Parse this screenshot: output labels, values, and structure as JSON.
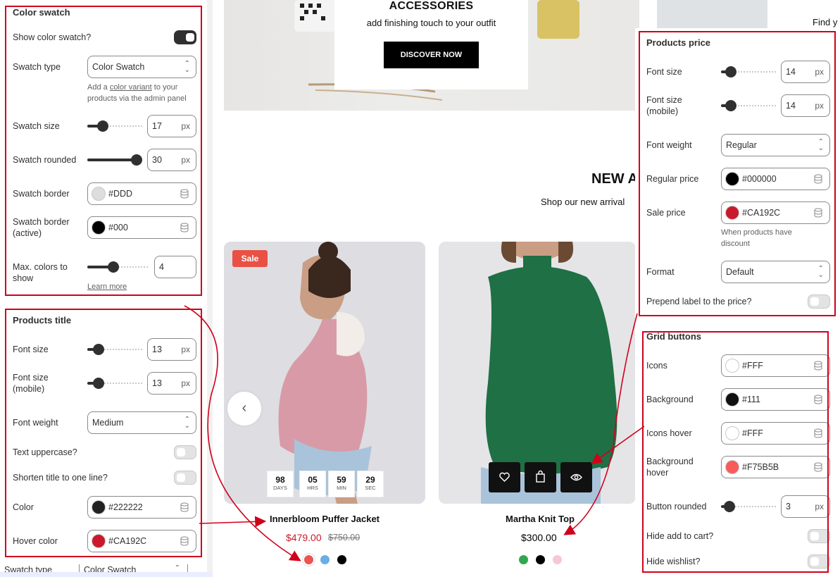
{
  "store": {
    "hero_title": "ACCESSORIES",
    "hero_subtitle": "add finishing touch to your outfit",
    "hero_button": "DISCOVER NOW",
    "find_text": "Find y",
    "section_title": "NEW A",
    "section_subtitle": "Shop our new arrival",
    "products": [
      {
        "title": "Innerbloom Puffer Jacket",
        "badge": "Sale",
        "sale_price": "$479.00",
        "compare_price": "$750.00",
        "countdown": [
          {
            "n": "98",
            "u": "DAYS"
          },
          {
            "n": "05",
            "u": "HRS"
          },
          {
            "n": "59",
            "u": "MIN"
          },
          {
            "n": "29",
            "u": "SEC"
          }
        ],
        "swatches": [
          "#ea5455",
          "#6aaee8",
          "#000000"
        ]
      },
      {
        "title": "Martha Knit Top",
        "price": "$300.00",
        "swatches": [
          "#2fa84f",
          "#000000",
          "#f7c7d4"
        ]
      }
    ],
    "prev_icon": "chevron-left-icon",
    "grid_icons": [
      "heart-icon",
      "bag-icon",
      "eye-icon"
    ]
  },
  "color_swatch": {
    "title": "Color swatch",
    "show_label": "Show color swatch?",
    "show_on": true,
    "type_label": "Swatch type",
    "type_value": "Color Swatch",
    "hint_pre": "Add a ",
    "hint_link": "color variant",
    "hint_post": " to your",
    "hint_line2": "products via the admin panel",
    "size_label": "Swatch size",
    "size_value": "17",
    "size_fraction": 0.22,
    "rounded_label": "Swatch rounded",
    "rounded_value": "30",
    "rounded_fraction": 1.0,
    "border_label": "Swatch border",
    "border_value": "#DDD",
    "border_color": "#dddddd",
    "border_active_label_1": "Swatch border",
    "border_active_label_2": "(active)",
    "border_active_value": "#000",
    "border_active_color": "#000000",
    "max_label_1": "Max. colors to",
    "max_label_2": "show",
    "max_value": "4",
    "max_fraction": 0.4,
    "learn_more": "Learn more",
    "unit": "px"
  },
  "products_title": {
    "title": "Products title",
    "font_size_label": "Font size",
    "font_size_value": "13",
    "font_size_mobile_label_1": "Font size",
    "font_size_mobile_label_2": "(mobile)",
    "font_size_mobile_value": "13",
    "font_weight_label": "Font weight",
    "font_weight_value": "Medium",
    "uppercase_label": "Text uppercase?",
    "shorten_label": "Shorten title to one line?",
    "color_label": "Color",
    "color_value": "#222222",
    "color_color": "#222222",
    "hover_label": "Hover color",
    "hover_value": "#CA192C",
    "hover_color": "#ca192c",
    "unit": "px"
  },
  "left_bottom": {
    "label": "Swatch type",
    "value": "Color Swatch"
  },
  "products_price": {
    "title": "Products price",
    "font_size_label": "Font size",
    "font_size_value": "14",
    "font_size_mobile_label_1": "Font size",
    "font_size_mobile_label_2": "(mobile)",
    "font_size_mobile_value": "14",
    "font_weight_label": "Font weight",
    "font_weight_value": "Regular",
    "regular_label": "Regular price",
    "regular_value": "#000000",
    "regular_color": "#000000",
    "sale_label": "Sale price",
    "sale_value": "#CA192C",
    "sale_color": "#ca192c",
    "sale_hint_1": "When products have",
    "sale_hint_2": "discount",
    "format_label": "Format",
    "format_value": "Default",
    "prepend_label": "Prepend label to the price?",
    "unit": "px"
  },
  "grid_buttons": {
    "title": "Grid buttons",
    "icons_label": "Icons",
    "icons_value": "#FFF",
    "icons_color": "#ffffff",
    "bg_label": "Background",
    "bg_value": "#111",
    "bg_color": "#111111",
    "icons_hover_label": "Icons hover",
    "icons_hover_value": "#FFF",
    "icons_hover_color": "#ffffff",
    "bg_hover_label_1": "Background",
    "bg_hover_label_2": "hover",
    "bg_hover_value": "#F75B5B",
    "bg_hover_color": "#f75b5b",
    "rounded_label": "Button rounded",
    "rounded_value": "3",
    "hide_cart_label": "Hide add to cart?",
    "hide_wishlist_label": "Hide wishlist?",
    "unit": "px"
  },
  "colors": {
    "annotation_red": "#d0021b",
    "sale_red": "#ca192c"
  }
}
